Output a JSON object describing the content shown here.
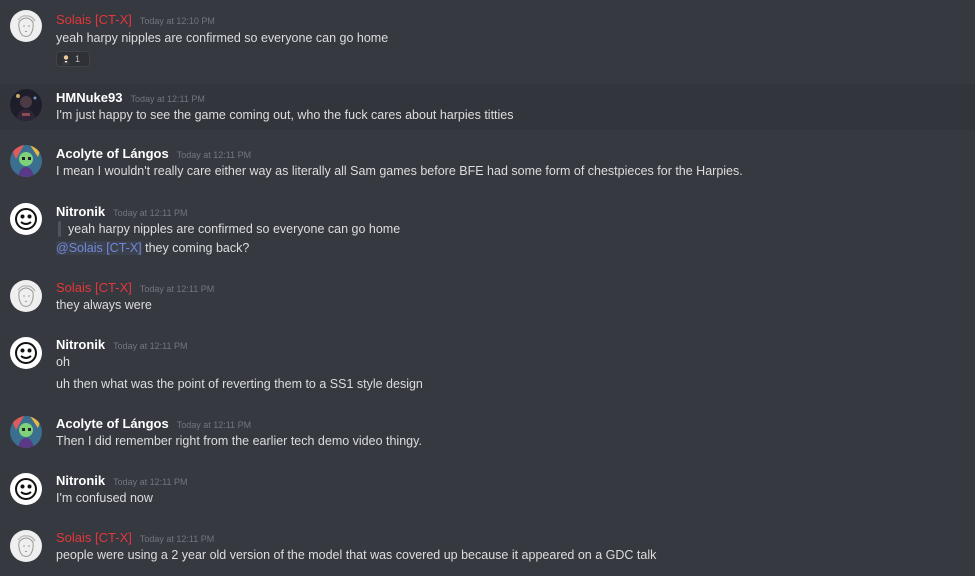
{
  "messages": [
    {
      "author": "Solais [CT-X]",
      "time": "Today at 12:10 PM",
      "lines": [
        "yeah harpy nipples are confirmed so everyone can go home"
      ],
      "reaction_count": "1"
    },
    {
      "author": "HMNuke93",
      "time": "Today at 12:11 PM",
      "lines": [
        "I'm just happy to see the game coming out, who the fuck cares about harpies titties"
      ]
    },
    {
      "author": "Acolyte of Lángos",
      "time": "Today at 12:11 PM",
      "lines": [
        "I mean I wouldn't really care either way as literally all Sam games before BFE had some form of chestpieces for the Harpies."
      ]
    },
    {
      "author": "Nitronik",
      "time": "Today at 12:11 PM",
      "quote": "yeah harpy nipples are confirmed so everyone can go home",
      "mention": "@Solais [CT-X]",
      "mention_rest": " they coming back?"
    },
    {
      "author": "Solais [CT-X]",
      "time": "Today at 12:11 PM",
      "lines": [
        "they always were"
      ]
    },
    {
      "author": "Nitronik",
      "time": "Today at 12:11 PM",
      "lines": [
        "oh",
        "uh then what was the point of reverting them to a SS1 style design"
      ]
    },
    {
      "author": "Acolyte of Lángos",
      "time": "Today at 12:11 PM",
      "lines": [
        "Then I did remember right from the earlier tech demo video thingy."
      ]
    },
    {
      "author": "Nitronik",
      "time": "Today at 12:11 PM",
      "lines": [
        "I'm confused now"
      ]
    },
    {
      "author": "Solais [CT-X]",
      "time": "Today at 12:11 PM",
      "lines": [
        "people were using a 2 year old version of the model that was covered up because it appeared on a GDC talk"
      ]
    }
  ],
  "colors": {
    "background": "#36393f",
    "highlight": "#32353b",
    "role_red": "#e1383b",
    "mention": "#7289da",
    "timestamp": "#72767d"
  },
  "icons": {
    "solais_avatar": "sketch-face-avatar",
    "hmnuke_avatar": "dark-art-avatar",
    "acolyte_avatar": "colorful-character-avatar",
    "nitronik_avatar": "cartoon-face-avatar",
    "reaction_emoji": "person-emoji"
  }
}
